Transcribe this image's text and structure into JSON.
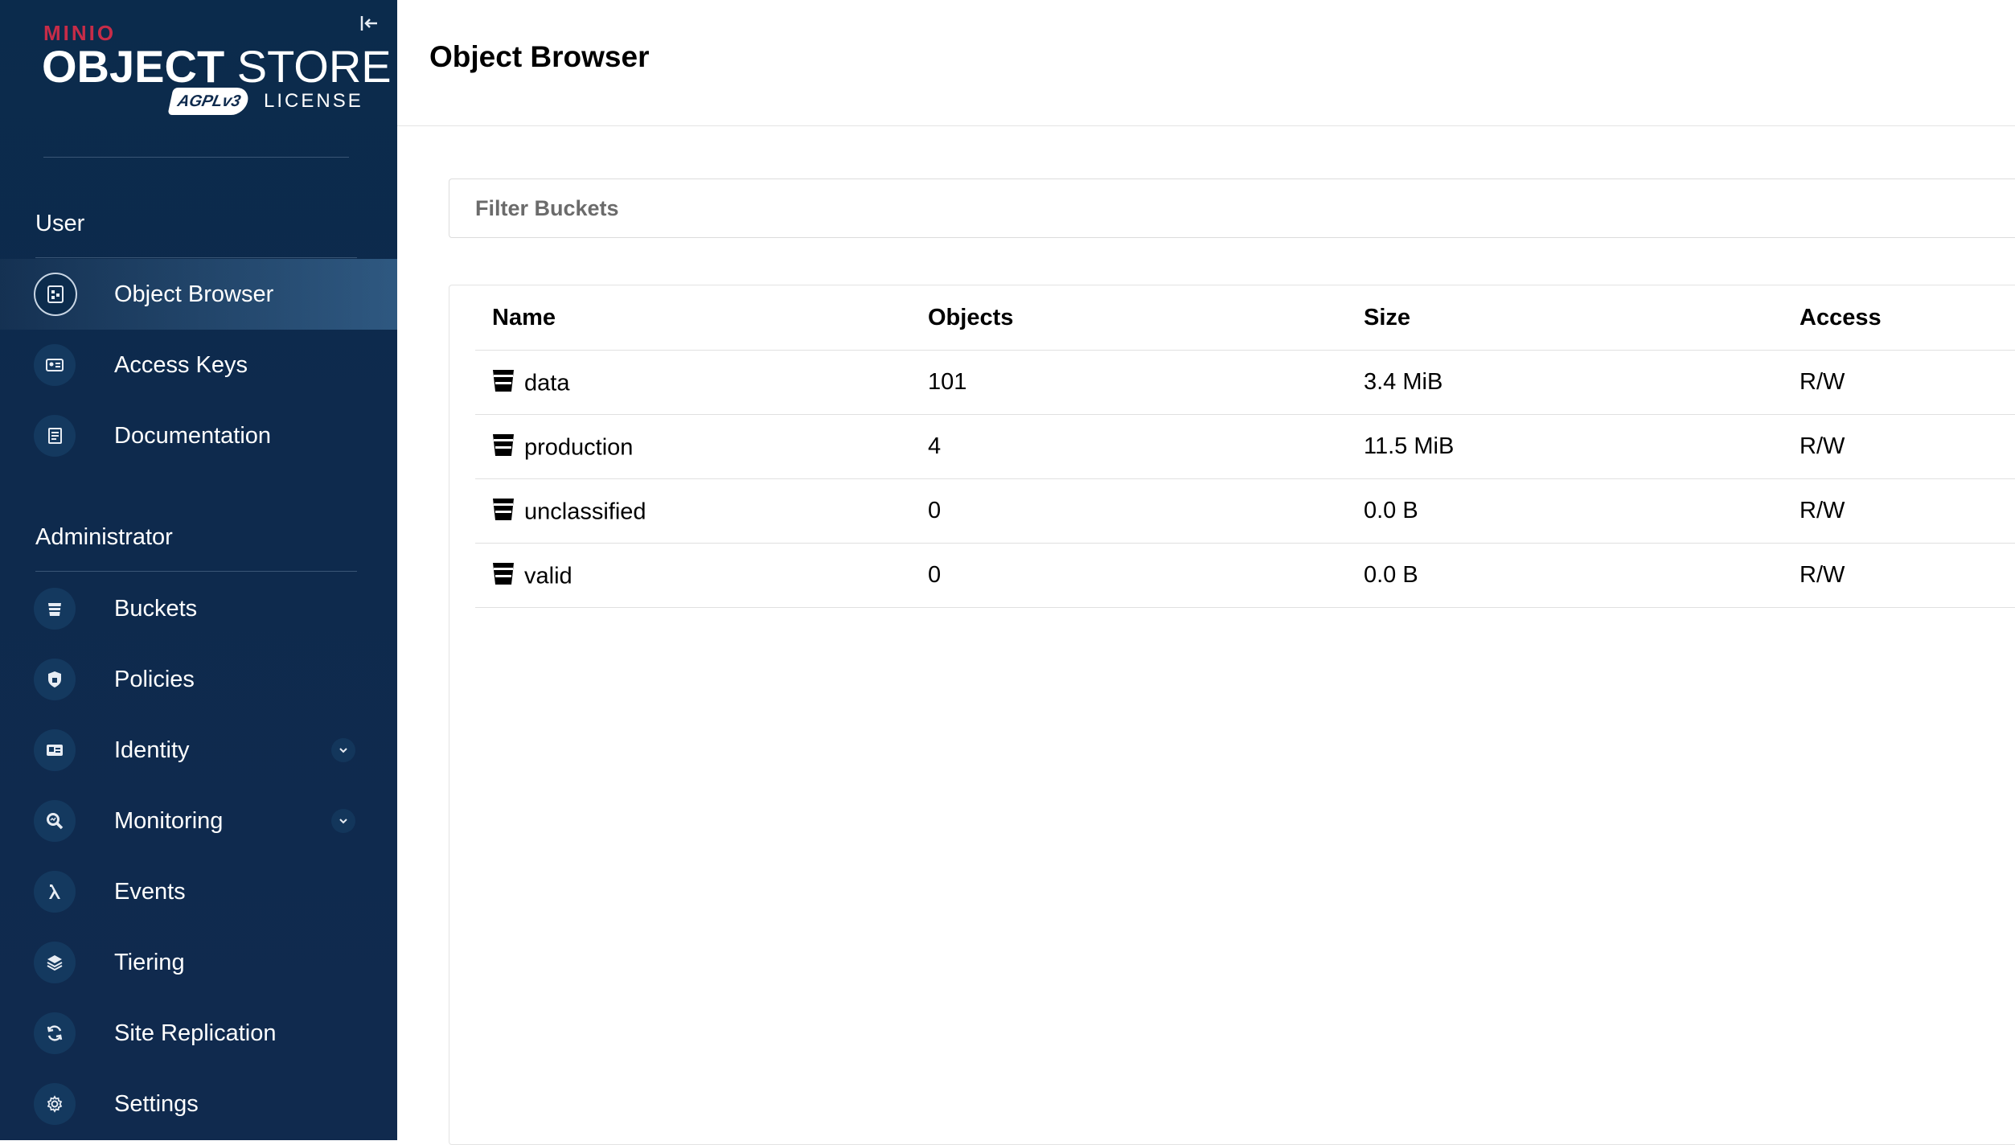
{
  "brand": {
    "minio": "MINIO",
    "title_bold": "OBJECT",
    "title_light": "STORE",
    "badge": "AGPLv3",
    "license": "LICENSE"
  },
  "sidebar": {
    "user_section": "User",
    "admin_section": "Administrator",
    "user_items": [
      {
        "label": "Object Browser",
        "icon": "object-browser-icon",
        "active": true
      },
      {
        "label": "Access Keys",
        "icon": "access-keys-icon"
      },
      {
        "label": "Documentation",
        "icon": "documentation-icon"
      }
    ],
    "admin_items": [
      {
        "label": "Buckets",
        "icon": "bucket-icon"
      },
      {
        "label": "Policies",
        "icon": "shield-icon"
      },
      {
        "label": "Identity",
        "icon": "id-card-icon",
        "expandable": true
      },
      {
        "label": "Monitoring",
        "icon": "monitoring-icon",
        "expandable": true
      },
      {
        "label": "Events",
        "icon": "lambda-icon"
      },
      {
        "label": "Tiering",
        "icon": "layers-icon"
      },
      {
        "label": "Site Replication",
        "icon": "sync-icon"
      },
      {
        "label": "Settings",
        "icon": "gear-icon"
      }
    ]
  },
  "main": {
    "title": "Object Browser",
    "filter_placeholder": "Filter Buckets",
    "columns": [
      "Name",
      "Objects",
      "Size",
      "Access"
    ],
    "rows": [
      {
        "name": "data",
        "objects": "101",
        "size": "3.4 MiB",
        "access": "R/W"
      },
      {
        "name": "production",
        "objects": "4",
        "size": "11.5 MiB",
        "access": "R/W"
      },
      {
        "name": "unclassified",
        "objects": "0",
        "size": "0.0 B",
        "access": "R/W"
      },
      {
        "name": "valid",
        "objects": "0",
        "size": "0.0 B",
        "access": "R/W"
      }
    ]
  },
  "colors": {
    "sidebar_bg": "#0e2a4d",
    "brand_red": "#c72c48",
    "active_item": "#4a7eab"
  }
}
